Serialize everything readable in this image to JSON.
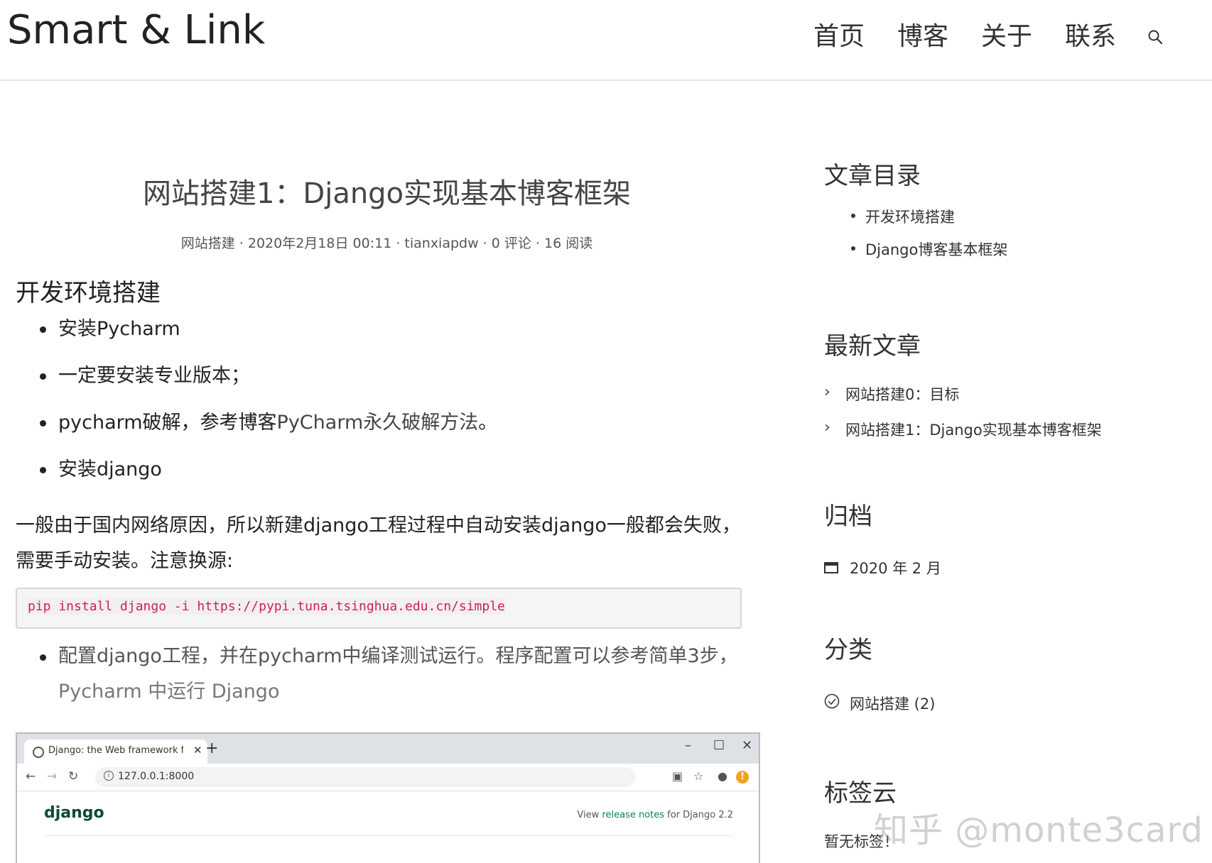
{
  "header": {
    "brand": "Smart & Link",
    "nav": [
      "首页",
      "博客",
      "关于",
      "联系"
    ]
  },
  "article": {
    "title": "网站搭建1：Django实现基本博客框架",
    "meta": "网站搭建 · 2020年2月18日 00:11 · tianxiapdw · 0 评论 · 16 阅读",
    "section1": "开发环境搭建",
    "bullets": {
      "b1": "安装Pycharm",
      "b2": "一定要安装专业版本；",
      "b3_pre": "pycharm破解，参考博客",
      "b3_link": "PyCharm永久破解方法",
      "b3_post": "。",
      "b4": "安装django"
    },
    "para1": "一般由于国内网络原因，所以新建django工程过程中自动安装django一般都会失败，",
    "para2": "需要手动安装。注意换源:",
    "code": "pip install django -i https://pypi.tuna.tsinghua.edu.cn/simple",
    "bullet5_line1": "配置django工程，并在pycharm中编译测试运行。程序配置可以参考简单3步，",
    "bullet5_line2": "Pycharm 中运行 Django"
  },
  "screenshot": {
    "tab_title": "Django: the Web framework fo",
    "url": "127.0.0.1:8000",
    "logo": "django",
    "release_pre": "View ",
    "release_link": "release notes",
    "release_post": " for Django 2.2"
  },
  "sidebar": {
    "toc_title": "文章目录",
    "toc": [
      "开发环境搭建",
      "Django博客基本框架"
    ],
    "recent_title": "最新文章",
    "recent": [
      "网站搭建0：目标",
      "网站搭建1：Django实现基本博客框架"
    ],
    "archive_title": "归档",
    "archive_item": "2020 年 2 月",
    "category_title": "分类",
    "category_item": "网站搭建 (2)",
    "tags_title": "标签云",
    "tags_empty": "暂无标签！"
  },
  "watermark": "知乎 @monte3card",
  "icons": {
    "search": "search-icon",
    "calendar": "calendar-icon",
    "check": "check-circle-icon",
    "chevron": "chevron-right-icon"
  }
}
